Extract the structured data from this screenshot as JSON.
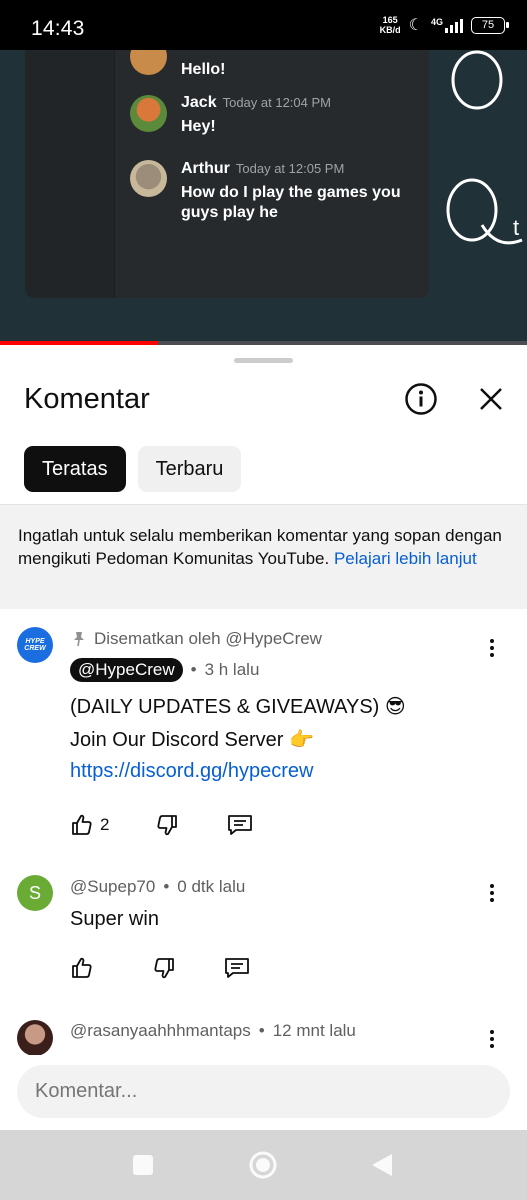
{
  "status_bar": {
    "time": "14:43",
    "net_speed_value": "165",
    "net_speed_unit": "KB/d",
    "network": "4G",
    "battery": "75"
  },
  "video": {
    "chat": [
      {
        "name": "",
        "timestamp": "",
        "text": "Hello!"
      },
      {
        "name": "Jack",
        "timestamp": "Today at 12:04 PM",
        "text": "Hey!"
      },
      {
        "name": "Arthur",
        "timestamp": "Today at 12:05 PM",
        "text": "How do I play the games you guys play he"
      }
    ],
    "progress": 0.3
  },
  "sheet": {
    "title": "Komentar",
    "tabs": [
      {
        "label": "Teratas",
        "active": true
      },
      {
        "label": "Terbaru",
        "active": false
      }
    ],
    "notice": {
      "text": "Ingatlah untuk selalu memberikan komentar yang sopan dengan mengikuti Pedoman Komunitas YouTube. ",
      "link": "Pelajari lebih lanjut"
    }
  },
  "comments": [
    {
      "pinned_label": "Disematkan oleh @HypeCrew",
      "author": "@HypeCrew",
      "time": "3 h lalu",
      "lines": [
        "(DAILY UPDATES & GIVEAWAYS) 😎",
        "Join Our Discord Server 👉"
      ],
      "link": "https://discord.gg/hypecrew",
      "likes": "2",
      "avatar_text": "HYPE CREW"
    },
    {
      "author": "@Supep70",
      "time": "0 dtk lalu",
      "text": "Super win",
      "avatar_letter": "S"
    },
    {
      "author": "@rasanyaahhhmantaps",
      "time": "12 mnt lalu"
    }
  ],
  "input": {
    "placeholder": "Komentar..."
  },
  "colors": {
    "accent_link": "#065fd4",
    "avatar_green": "#6aab36",
    "progress": "#ff0000"
  }
}
